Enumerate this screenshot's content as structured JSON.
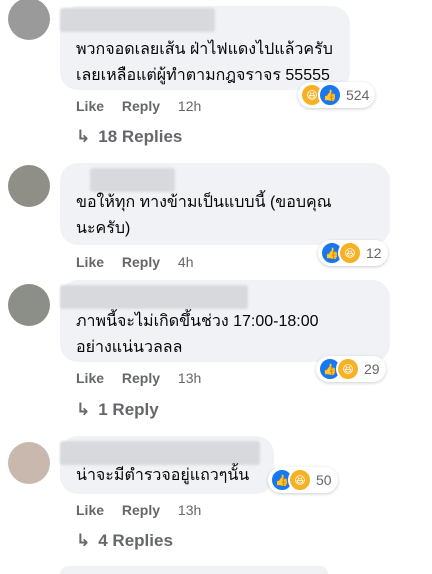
{
  "comments": [
    {
      "text_lines": [
        "พวกจอดเลยเส้น ฝ่าไฟแดงไปแล้วครับ",
        "เลยเหลือแต่ผู้ทำตามกฎจราจร 55555"
      ],
      "reactions": {
        "icons": [
          "haha-icon",
          "like-icon"
        ],
        "count": "524"
      },
      "actions": {
        "like": "Like",
        "reply": "Reply",
        "time": "12h"
      },
      "replies": "18 Replies"
    },
    {
      "text_lines": [
        "ขอให้ทุก ทางข้ามเป็นแบบนี้ (ขอบคุณ",
        "นะครับ)"
      ],
      "reactions": {
        "icons": [
          "like-icon",
          "haha-icon"
        ],
        "count": "12"
      },
      "actions": {
        "like": "Like",
        "reply": "Reply",
        "time": "4h"
      },
      "replies": ""
    },
    {
      "text_lines": [
        "ภาพนี้จะไม่เกิดขึ้นช่วง 17:00-18:00",
        "อย่างแน่นวลลล"
      ],
      "reactions": {
        "icons": [
          "like-icon",
          "haha-icon"
        ],
        "count": "29"
      },
      "actions": {
        "like": "Like",
        "reply": "Reply",
        "time": "13h"
      },
      "replies": "1 Reply"
    },
    {
      "text_lines": [
        "น่าจะมีตำรวจอยู่แถวๆนั้น"
      ],
      "reactions": {
        "icons": [
          "like-icon",
          "haha-icon"
        ],
        "count": "50"
      },
      "actions": {
        "like": "Like",
        "reply": "Reply",
        "time": "13h"
      },
      "replies": "4 Replies"
    }
  ],
  "colors": {
    "bubble": "#f0f2f5",
    "like": "#1877f2",
    "haha": "#f7b125",
    "secondary_text": "#65676b"
  }
}
